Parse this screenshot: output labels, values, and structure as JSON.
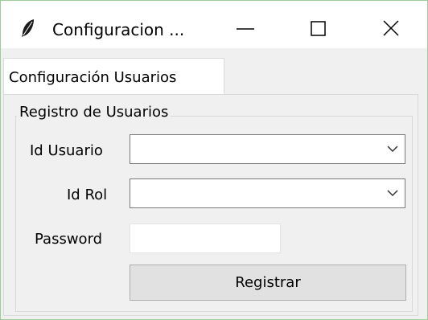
{
  "window": {
    "title": "Configuracion ...",
    "app_icon": "feather-icon",
    "controls": {
      "minimize_icon": "minimize-icon",
      "maximize_icon": "maximize-icon",
      "close_icon": "close-icon"
    }
  },
  "tabs": [
    {
      "label": "Configuración Usuarios",
      "selected": true
    }
  ],
  "form": {
    "group_title": "Registro de Usuarios",
    "fields": {
      "id_usuario": {
        "label": "Id Usuario",
        "value": ""
      },
      "id_rol": {
        "label": "Id Rol",
        "value": ""
      },
      "password": {
        "label": "Password",
        "value": ""
      }
    },
    "dropdown_icon": "chevron-down-icon",
    "submit_label": "Registrar"
  },
  "colors": {
    "window_border": "#9ccf96",
    "titlebar_bg": "#ffffff",
    "client_bg": "#f0f0f0",
    "button_bg": "#e1e1e1"
  }
}
